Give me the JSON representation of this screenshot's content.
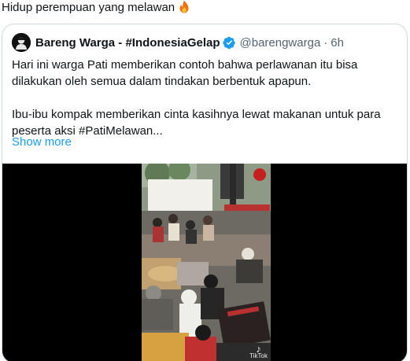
{
  "tweet": {
    "text": "Hidup perempuan yang melawan",
    "emoji_icon": "fire-icon"
  },
  "quoted": {
    "author_name": "Bareng Warga - #IndonesiaGelap",
    "verified_icon": "verified-badge-icon",
    "handle": "@barengwarga",
    "separator": "·",
    "time": "6h",
    "lines": [
      "Hari ini warga Pati memberikan contoh bahwa perlawanan itu bisa",
      "dilakukan oleh semua dalam tindakan berbentuk apapun.",
      "",
      "Ibu-ibu kompak memberikan cinta kasihnya lewat makanan untuk para",
      "peserta aksi #PatiMelawan..."
    ],
    "show_more": "Show more"
  },
  "media": {
    "type": "video",
    "watermark_icon": "tiktok-icon",
    "watermark": "TikTok"
  },
  "colors": {
    "text": "#0f1419",
    "secondary": "#536471",
    "link": "#1d9bf0",
    "border": "#cfd9de",
    "verified": "#1d9bf0"
  }
}
